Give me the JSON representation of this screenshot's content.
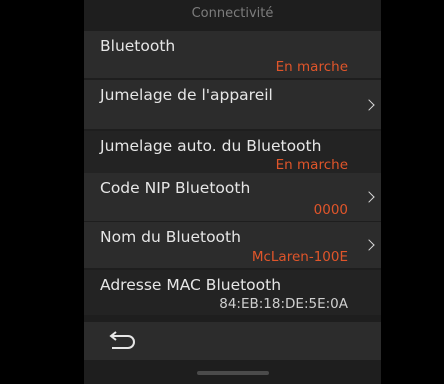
{
  "header": {
    "title": "Connectivité"
  },
  "settings": [
    {
      "label": "Bluetooth",
      "value": "En marche"
    },
    {
      "label": "Jumelage de l'appareil",
      "value": ""
    },
    {
      "label": "Jumelage auto. du Bluetooth",
      "value": "En marche"
    },
    {
      "label": "Code NIP Bluetooth",
      "value": "0000"
    },
    {
      "label": "Nom du Bluetooth",
      "value": "McLaren-100E"
    },
    {
      "label": "Adresse MAC Bluetooth",
      "value": "84:EB:18:DE:5E:0A"
    }
  ],
  "icons": {
    "chevron": "chevron-right-icon",
    "back": "back-arrow-icon"
  },
  "colors": {
    "accent": "#e0552a",
    "panel": "#2c2c2c",
    "background": "#000000"
  }
}
